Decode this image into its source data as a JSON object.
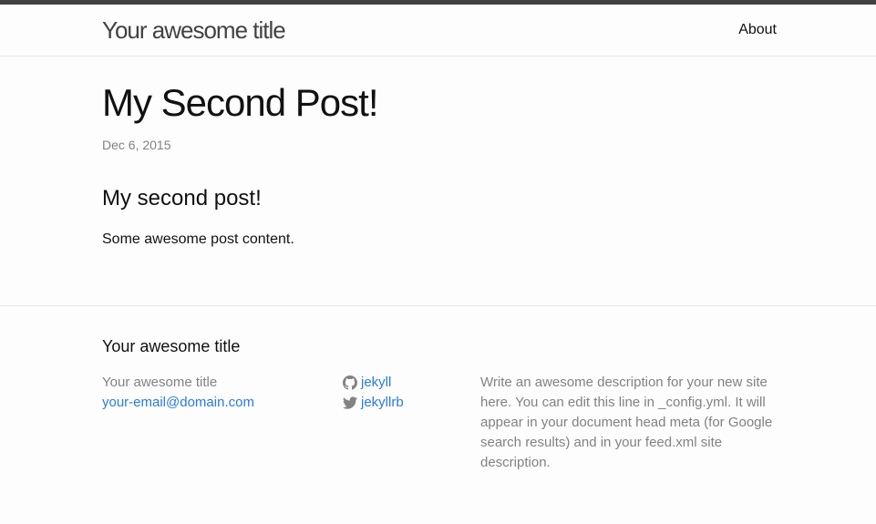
{
  "header": {
    "site_title": "Your awesome title",
    "nav": {
      "about": "About"
    }
  },
  "post": {
    "title": "My Second Post!",
    "date": "Dec 6, 2015",
    "heading": "My second post!",
    "content": "Some awesome post content."
  },
  "footer": {
    "heading": "Your awesome title",
    "name": "Your awesome title",
    "email": "your-email@domain.com",
    "github": {
      "icon": "github-icon",
      "username": "jekyll"
    },
    "twitter": {
      "icon": "twitter-icon",
      "username": "jekyllrb"
    },
    "description": "Write an awesome description for your new site here. You can edit this line in _config.yml. It will appear in your document head meta (for Google search results) and in your feed.xml site description."
  },
  "colors": {
    "background": "#fdfdfd",
    "text": "#111111",
    "grey": "#828282",
    "link": "#2a7ae2",
    "header_border": "#424242"
  }
}
